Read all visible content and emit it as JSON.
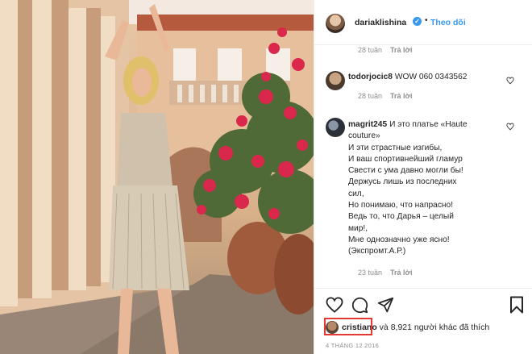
{
  "post": {
    "author": "dariaklishina",
    "follow_label": "Theo dõi",
    "dot": "•",
    "verified_mark": "✓"
  },
  "comments": [
    {
      "meta_time": "28 tuần",
      "meta_reply": "Trả lời"
    },
    {
      "username": "todorjocic8",
      "text": "WOW 060 0343562",
      "time": "28 tuần",
      "reply": "Trả lời"
    },
    {
      "username": "magrit245",
      "lines": [
        "И это платье «Haute",
        "couture»",
        "И эти страстные изгибы,",
        "И ваш спортивнейший гламур",
        "Свести с ума давно могли бы!",
        "Держусь лишь из последних",
        "сил,",
        "Но понимаю, что напрасно!",
        "Ведь то, что Дарья – целый",
        "мир!,",
        "Мне однозначно уже ясно!",
        "(Экспромт.А.Р.)"
      ],
      "time": "23 tuần",
      "reply": "Trả lời"
    }
  ],
  "likes": {
    "first_user": "cristiano",
    "rest": " và 8,921 người khác đã thích"
  },
  "date": "4 THÁNG 12 2016",
  "icons": [
    "like-heart-icon",
    "comment-icon",
    "share-icon",
    "bookmark-icon",
    "verified-badge-icon"
  ],
  "colors": {
    "link": "#3897f0",
    "highlight": "#e53935",
    "muted": "#8e8e8e"
  }
}
